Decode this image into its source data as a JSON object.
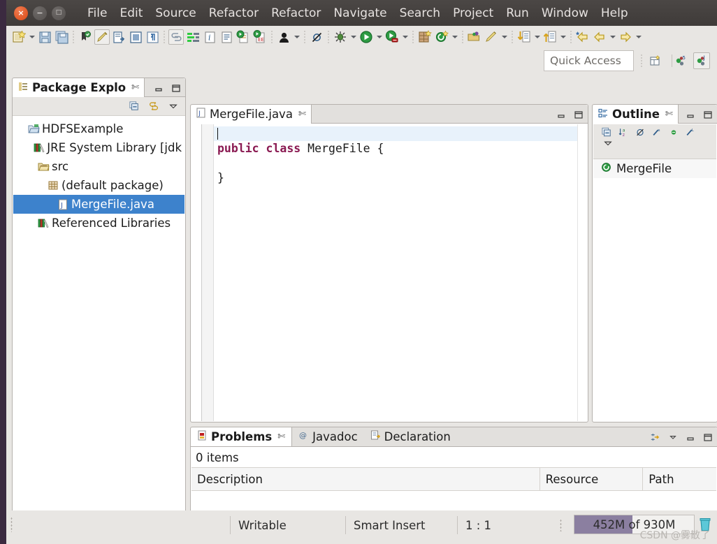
{
  "window": {
    "controls": {
      "close": "×",
      "minimize": "−",
      "maximize": "□"
    },
    "menu": [
      "File",
      "Edit",
      "Source",
      "Refactor",
      "Refactor",
      "Navigate",
      "Search",
      "Project",
      "Run",
      "Window",
      "Help"
    ]
  },
  "toolbar": {
    "groups": [
      {
        "items": [
          {
            "name": "new-wizard-icon",
            "arrow": true
          },
          {
            "name": "save-icon",
            "arrow": false
          },
          {
            "name": "save-all-icon",
            "arrow": false
          }
        ]
      },
      {
        "items": [
          {
            "name": "toggle-mark-occurrences-icon",
            "arrow": false
          },
          {
            "name": "external-tools-icon",
            "arrow": false,
            "framed": true
          },
          {
            "name": "open-task-icon",
            "arrow": false
          },
          {
            "name": "toggle-block-selection-icon",
            "arrow": false
          },
          {
            "name": "show-whitespace-icon",
            "arrow": false
          }
        ]
      },
      {
        "items": [
          {
            "name": "link-with-editor-icon",
            "arrow": false,
            "framed": true
          },
          {
            "name": "coverage-icon",
            "arrow": false
          },
          {
            "name": "java-info-icon",
            "arrow": false
          },
          {
            "name": "document-icon",
            "arrow": false
          },
          {
            "name": "run-script-icon",
            "arrow": false
          },
          {
            "name": "debug-script-icon",
            "arrow": false
          }
        ]
      },
      {
        "items": [
          {
            "name": "user-profile-icon",
            "arrow": true
          }
        ]
      },
      {
        "items": [
          {
            "name": "skip-breakpoints-icon",
            "arrow": false
          }
        ]
      },
      {
        "items": [
          {
            "name": "debug-icon",
            "arrow": true
          },
          {
            "name": "run-icon",
            "arrow": true
          },
          {
            "name": "coverage-run-icon",
            "arrow": true
          }
        ]
      },
      {
        "items": [
          {
            "name": "new-java-project-icon",
            "arrow": false
          },
          {
            "name": "new-class-icon",
            "arrow": true
          }
        ]
      },
      {
        "items": [
          {
            "name": "open-type-icon",
            "arrow": false
          },
          {
            "name": "new-annotation-icon",
            "arrow": true
          }
        ]
      },
      {
        "items": [
          {
            "name": "previous-annotation-icon",
            "arrow": true
          },
          {
            "name": "next-annotation-icon",
            "arrow": true
          }
        ]
      },
      {
        "items": [
          {
            "name": "back-marked-icon",
            "arrow": false
          },
          {
            "name": "back-icon",
            "arrow": true
          },
          {
            "name": "forward-icon",
            "arrow": true
          }
        ]
      }
    ]
  },
  "quick_access": {
    "placeholder": "Quick Access"
  },
  "perspectives": [
    {
      "name": "open-perspective-icon"
    },
    {
      "name": "resource-perspective-icon"
    },
    {
      "name": "java-perspective-icon",
      "active": true
    }
  ],
  "package_explorer": {
    "title": "Package Explo",
    "close_glyph": "✄",
    "view_buttons": [
      {
        "name": "collapse-all-icon"
      },
      {
        "name": "link-with-editor-icon"
      },
      {
        "name": "view-menu-icon"
      }
    ],
    "tab_buttons": [
      {
        "name": "minimize-view-icon"
      },
      {
        "name": "maximize-view-icon"
      }
    ],
    "tree": [
      {
        "label": "HDFSExample",
        "depth": 0,
        "twisty": "▾",
        "icon": "project-icon",
        "selected": false
      },
      {
        "label": "JRE System Library [jdk",
        "depth": 1,
        "twisty": "▸",
        "icon": "library-icon",
        "selected": false
      },
      {
        "label": "src",
        "depth": 1,
        "twisty": "▾",
        "icon": "source-folder-icon",
        "selected": false
      },
      {
        "label": "(default package)",
        "depth": 2,
        "twisty": "▾",
        "icon": "package-icon",
        "selected": false
      },
      {
        "label": "MergeFile.java",
        "depth": 3,
        "twisty": "·",
        "icon": "java-file-icon",
        "selected": true
      },
      {
        "label": "Referenced Libraries",
        "depth": 1,
        "twisty": "▸",
        "icon": "library-icon",
        "selected": false
      }
    ]
  },
  "editor": {
    "tab": {
      "label": "MergeFile.java",
      "icon": "java-file-icon",
      "close_glyph": "✄"
    },
    "tab_buttons": [
      {
        "name": "minimize-editor-icon"
      },
      {
        "name": "maximize-editor-icon"
      }
    ],
    "lines": [
      {
        "segments": [],
        "highlight": true,
        "caret": true
      },
      {
        "segments": [
          {
            "t": "public",
            "k": "kw"
          },
          {
            "t": " ",
            "k": "plain"
          },
          {
            "t": "class",
            "k": "kw"
          },
          {
            "t": " MergeFile {",
            "k": "plain"
          }
        ],
        "highlight": false,
        "caret": false
      },
      {
        "segments": [],
        "highlight": false,
        "caret": false
      },
      {
        "segments": [
          {
            "t": "}",
            "k": "plain"
          }
        ],
        "highlight": false,
        "caret": false
      }
    ]
  },
  "outline": {
    "title": "Outline",
    "close_glyph": "✄",
    "view_buttons": [
      {
        "name": "collapse-all-icon"
      },
      {
        "name": "sort-icon"
      },
      {
        "name": "hide-fields-icon"
      },
      {
        "name": "hide-static-icon"
      },
      {
        "name": "hide-public-icon"
      },
      {
        "name": "hide-local-icon"
      }
    ],
    "menu_button": {
      "name": "view-menu-icon"
    },
    "tab_buttons": [
      {
        "name": "minimize-view-icon"
      },
      {
        "name": "maximize-view-icon"
      }
    ],
    "items": [
      {
        "label": "MergeFile",
        "icon": "class-icon"
      }
    ]
  },
  "problems": {
    "tabs": [
      {
        "label": "Problems",
        "icon": "problems-icon",
        "active": true,
        "close_glyph": "✄"
      },
      {
        "label": "Javadoc",
        "icon": "javadoc-icon",
        "active": false
      },
      {
        "label": "Declaration",
        "icon": "declaration-icon",
        "active": false
      }
    ],
    "view_buttons": [
      {
        "name": "focus-on-selection-icon"
      },
      {
        "name": "view-menu-icon"
      },
      {
        "name": "minimize-view-icon"
      },
      {
        "name": "maximize-view-icon"
      }
    ],
    "item_count": "0 items",
    "columns": [
      "Description",
      "Resource",
      "Path"
    ],
    "rows": []
  },
  "status_bar": {
    "writable": "Writable",
    "insert_mode": "Smart Insert",
    "position": "1 : 1",
    "memory": {
      "text": "452M of 930M",
      "used_mb": 452,
      "total_mb": 930,
      "percent": 48.6
    },
    "trash_icon": "trash-icon"
  },
  "watermark": "CSDN @雾散了",
  "colors": {
    "selection_blue": "#3d82cc",
    "keyword_maroon": "#8a1a52",
    "titlebar": "#413d3b",
    "chrome": "#e8e6e3",
    "memory_bar": "#8b7fa0",
    "desktop": "#3b2a40"
  }
}
